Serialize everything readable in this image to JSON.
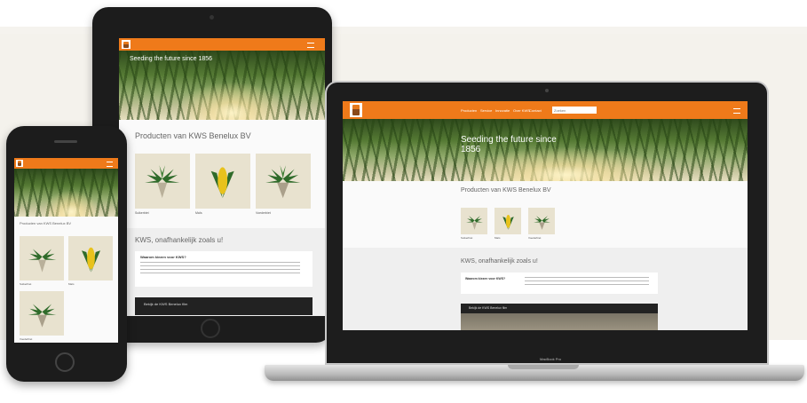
{
  "site": {
    "hero_title": "Seeding the future since 1856",
    "products_heading": "Producten van KWS Benelux BV",
    "products": [
      {
        "label": "Suikerbiet",
        "icon": "sugarbeet-icon"
      },
      {
        "label": "Maïs",
        "icon": "corn-icon"
      },
      {
        "label": "Voederbiet",
        "icon": "fodderbeet-icon"
      }
    ],
    "section_heading": "KWS, onafhankelijk zoals u!",
    "card_title": "Waarom kiezen voor KWS?",
    "video_title": "Bekijk de KWS Benelux film",
    "nav_items": [
      "Producten",
      "Service",
      "Innovatie",
      "Over KWS",
      "Contact"
    ],
    "search_placeholder": "Zoeken",
    "laptop_brand": "MacBook Pro"
  },
  "colors": {
    "accent": "#ef7a1a",
    "product_bg": "#e8e2cf"
  }
}
